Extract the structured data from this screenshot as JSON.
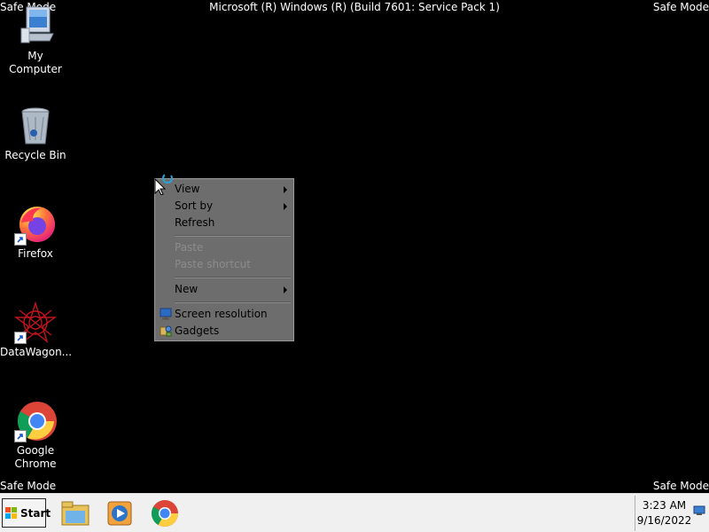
{
  "screen": {
    "safe_mode_label": "Safe Mode",
    "build_title": "Microsoft (R) Windows (R) (Build 7601: Service Pack 1)"
  },
  "desktop_icons": [
    {
      "label": "My Computer",
      "icon": "computer-icon"
    },
    {
      "label": "Recycle Bin",
      "icon": "recycle-bin-icon"
    },
    {
      "label": "Firefox",
      "icon": "firefox-icon",
      "shortcut": true
    },
    {
      "label": "DataWagon...",
      "icon": "datawagon-icon",
      "shortcut": true
    },
    {
      "label": "Google Chrome",
      "icon": "chrome-icon",
      "shortcut": true
    }
  ],
  "context_menu": {
    "items": [
      {
        "label": "View",
        "submenu": true,
        "enabled": true
      },
      {
        "label": "Sort by",
        "submenu": true,
        "enabled": true
      },
      {
        "label": "Refresh",
        "enabled": true
      },
      {
        "label": "Paste",
        "enabled": false
      },
      {
        "label": "Paste shortcut",
        "enabled": false
      },
      {
        "label": "New",
        "submenu": true,
        "enabled": true
      },
      {
        "label": "Screen resolution",
        "icon": "monitor-icon",
        "enabled": true
      },
      {
        "label": "Gadgets",
        "icon": "gadgets-icon",
        "enabled": true
      }
    ]
  },
  "taskbar": {
    "start_label": "Start",
    "pinned": [
      "explorer-icon",
      "media-player-icon",
      "chrome-icon"
    ],
    "clock": {
      "time": "3:23 AM",
      "date": "9/16/2022"
    }
  },
  "colors": {
    "desktop_bg": "#000000",
    "menu_bg": "#6d6d6d",
    "taskbar_bg": "#f0f0f0"
  }
}
